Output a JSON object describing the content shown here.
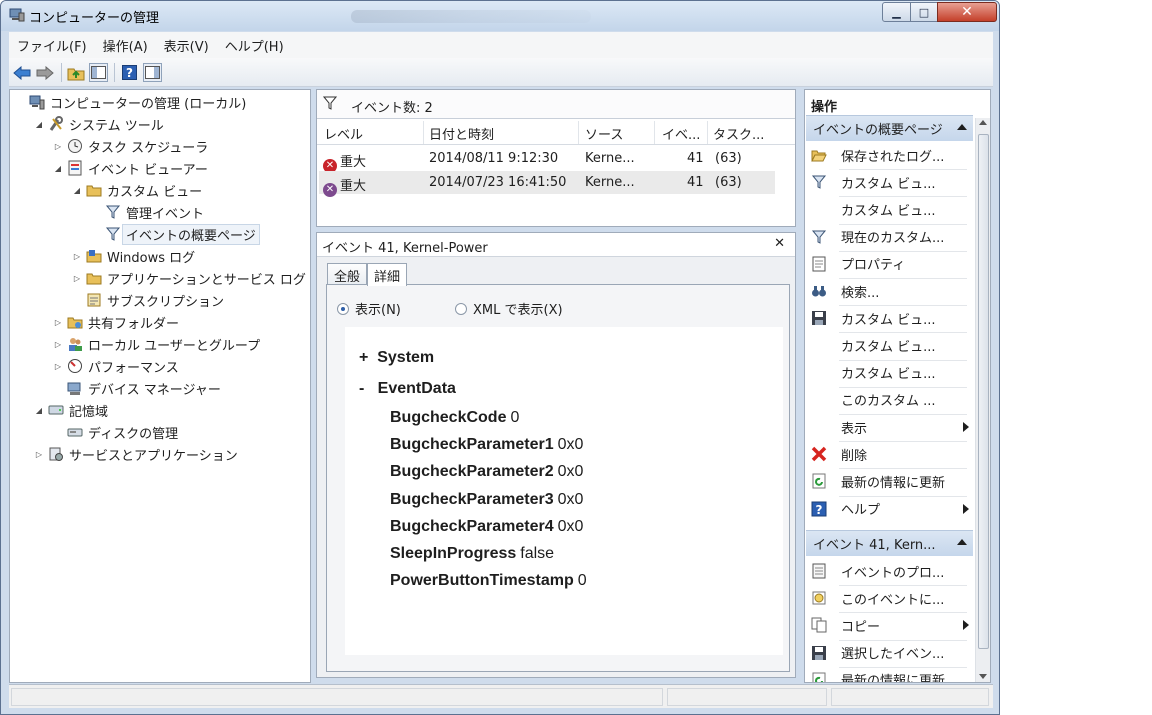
{
  "window": {
    "title": "コンピューターの管理",
    "controls": {
      "minimize": "▁",
      "maximize": "□",
      "close": "✕"
    }
  },
  "menu": [
    "ファイル(F)",
    "操作(A)",
    "表示(V)",
    "ヘルプ(H)"
  ],
  "toolbar": [
    "back-arrow-icon",
    "forward-arrow-icon",
    "up-folder-icon",
    "show-hide-tree-icon",
    "help-icon",
    "properties-icon"
  ],
  "tree": [
    {
      "label": "コンピューターの管理 (ローカル)",
      "level": 0,
      "toggle": "",
      "icon": "computer-icon"
    },
    {
      "label": "システム ツール",
      "level": 1,
      "toggle": "◢",
      "icon": "tools-icon"
    },
    {
      "label": "タスク スケジューラ",
      "level": 2,
      "toggle": "▷",
      "icon": "clock-icon"
    },
    {
      "label": "イベント ビューアー",
      "level": 2,
      "toggle": "◢",
      "icon": "event-viewer-icon"
    },
    {
      "label": "カスタム ビュー",
      "level": 3,
      "toggle": "◢",
      "icon": "folder-icon"
    },
    {
      "label": "管理イベント",
      "level": 4,
      "toggle": "",
      "icon": "filter-icon"
    },
    {
      "label": "イベントの概要ページ",
      "level": 4,
      "toggle": "",
      "icon": "filter-icon",
      "selected": true
    },
    {
      "label": "Windows ログ",
      "level": 3,
      "toggle": "▷",
      "icon": "log-folder-icon"
    },
    {
      "label": "アプリケーションとサービス ログ",
      "level": 3,
      "toggle": "▷",
      "icon": "folder-icon"
    },
    {
      "label": "サブスクリプション",
      "level": 3,
      "toggle": "",
      "icon": "subscription-icon"
    },
    {
      "label": "共有フォルダー",
      "level": 2,
      "toggle": "▷",
      "icon": "shared-folder-icon"
    },
    {
      "label": "ローカル ユーザーとグループ",
      "level": 2,
      "toggle": "▷",
      "icon": "users-icon"
    },
    {
      "label": "パフォーマンス",
      "level": 2,
      "toggle": "▷",
      "icon": "performance-icon"
    },
    {
      "label": "デバイス マネージャー",
      "level": 2,
      "toggle": "",
      "icon": "device-manager-icon"
    },
    {
      "label": "記憶域",
      "level": 1,
      "toggle": "◢",
      "icon": "storage-icon"
    },
    {
      "label": "ディスクの管理",
      "level": 2,
      "toggle": "",
      "icon": "disk-icon"
    },
    {
      "label": "サービスとアプリケーション",
      "level": 1,
      "toggle": "▷",
      "icon": "services-icon"
    }
  ],
  "events_list": {
    "header": "イベント数: 2",
    "columns": [
      "レベル",
      "日付と時刻",
      "ソース",
      "イベ...",
      "タスク..."
    ],
    "rows": [
      {
        "level": "重大",
        "datetime": "2014/08/11 9:12:30",
        "source": "Kerne...",
        "id": "41",
        "task": "(63)"
      },
      {
        "level": "重大",
        "datetime": "2014/07/23 16:41:50",
        "source": "Kerne...",
        "id": "41",
        "task": "(63)"
      }
    ]
  },
  "detail": {
    "title": "イベント 41, Kernel-Power",
    "close": "✕",
    "tabs": [
      "全般",
      "詳細"
    ],
    "view_options": [
      "表示(N)",
      "XML で表示(X)"
    ],
    "system_label": "System",
    "system_toggle": "+",
    "eventdata_label": "EventData",
    "eventdata_toggle": "-",
    "fields": [
      {
        "name": "BugcheckCode",
        "value": "0"
      },
      {
        "name": "BugcheckParameter1",
        "value": "0x0"
      },
      {
        "name": "BugcheckParameter2",
        "value": "0x0"
      },
      {
        "name": "BugcheckParameter3",
        "value": "0x0"
      },
      {
        "name": "BugcheckParameter4",
        "value": "0x0"
      },
      {
        "name": "SleepInProgress",
        "value": "false"
      },
      {
        "name": "PowerButtonTimestamp",
        "value": "0"
      }
    ]
  },
  "actions": {
    "title": "操作",
    "section1": "イベントの概要ページ",
    "items1": [
      {
        "label": "保存されたログ...",
        "icon": "open-folder-icon"
      },
      {
        "label": "カスタム ビュ...",
        "icon": "filter-icon"
      },
      {
        "label": "カスタム ビュ...",
        "icon": ""
      },
      {
        "label": "現在のカスタム...",
        "icon": "filter-icon"
      },
      {
        "label": "プロパティ",
        "icon": "properties-icon"
      },
      {
        "label": "検索...",
        "icon": "binoculars-icon"
      },
      {
        "label": "カスタム ビュ...",
        "icon": "save-icon"
      },
      {
        "label": "カスタム ビュ...",
        "icon": ""
      },
      {
        "label": "カスタム ビュ...",
        "icon": ""
      },
      {
        "label": "このカスタム ...",
        "icon": ""
      },
      {
        "label": "表示",
        "icon": "",
        "submenu": true
      },
      {
        "label": "削除",
        "icon": "delete-icon"
      },
      {
        "label": "最新の情報に更新",
        "icon": "refresh-icon"
      },
      {
        "label": "ヘルプ",
        "icon": "help-icon",
        "submenu": true
      }
    ],
    "section2": "イベント 41, Kern...",
    "items2": [
      {
        "label": "イベントのプロ...",
        "icon": "event-properties-icon"
      },
      {
        "label": "このイベントに...",
        "icon": "attach-task-icon"
      },
      {
        "label": "コピー",
        "icon": "copy-icon",
        "submenu": true
      },
      {
        "label": "選択したイベン...",
        "icon": "save-icon"
      },
      {
        "label": "最新の情報に更新",
        "icon": "refresh-icon"
      }
    ]
  },
  "colors": {
    "critical": "#c8242b",
    "selection": "#eef3f9",
    "section_header": "#c5d6eb"
  }
}
